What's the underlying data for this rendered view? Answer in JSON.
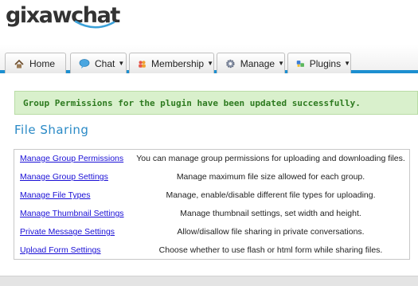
{
  "logo": {
    "text": "gixawchat"
  },
  "nav": {
    "tabs": [
      {
        "label": "Home",
        "icon": "home-icon",
        "has_caret": false
      },
      {
        "label": "Chat",
        "icon": "chat-bubble-icon",
        "has_caret": true
      },
      {
        "label": "Membership",
        "icon": "users-icon",
        "has_caret": true
      },
      {
        "label": "Manage",
        "icon": "gear-icon",
        "has_caret": true
      },
      {
        "label": "Plugins",
        "icon": "plugin-icon",
        "has_caret": true
      }
    ],
    "caret": "▼",
    "accent_color": "#1c8fd0"
  },
  "alert": {
    "message": "Group Permissions for the plugin have been updated successfully."
  },
  "page": {
    "title": "File Sharing"
  },
  "settings": [
    {
      "link": "Manage Group Permissions",
      "description": "You can manage group permissions for uploading and downloading files."
    },
    {
      "link": "Manage Group Settings",
      "description": "Manage maximum file size allowed for each group."
    },
    {
      "link": "Manage File Types",
      "description": "Manage, enable/disable different file types for uploading."
    },
    {
      "link": "Manage Thumbnail Settings",
      "description": "Manage thumbnail settings, set width and height."
    },
    {
      "link": "Private Message Settings",
      "description": "Allow/disallow file sharing in private conversations."
    },
    {
      "link": "Upload Form Settings",
      "description": "Choose whether to use flash or html form while sharing files."
    }
  ]
}
